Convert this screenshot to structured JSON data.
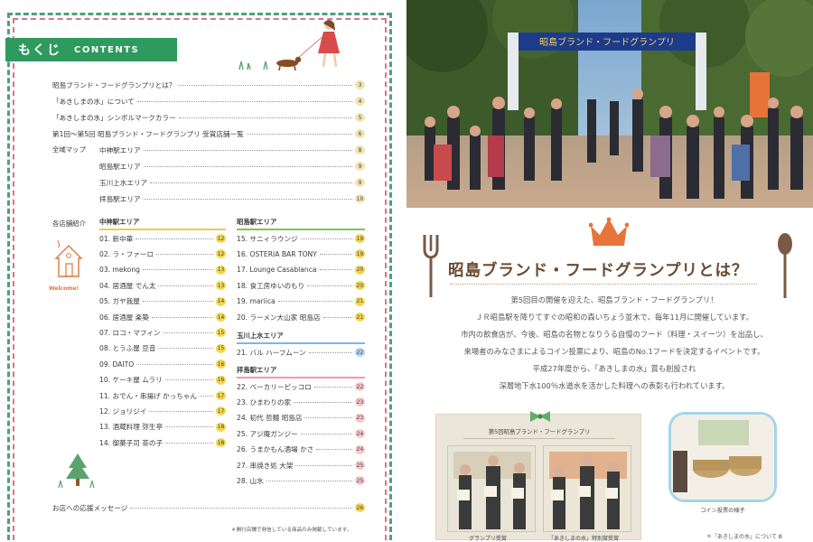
{
  "left": {
    "contents_jp": "もくじ",
    "contents_en": "CONTENTS",
    "toc": [
      {
        "label": "昭島ブランド・フードグランプリとは？",
        "page": "3"
      },
      {
        "label": "「あきしまの水」について",
        "page": "4"
      },
      {
        "label": "「あきしまの水」シンボルマークカラー",
        "page": "5"
      },
      {
        "label": "第1回〜第5回 昭島ブランド・フードグランプリ 受賞店舗一覧",
        "page": "6"
      }
    ],
    "map_label": "全域マップ",
    "map_items": [
      {
        "label": "中神駅エリア",
        "page": "8"
      },
      {
        "label": "昭島駅エリア",
        "page": "9"
      },
      {
        "label": "玉川上水エリア",
        "page": "9"
      },
      {
        "label": "拝島駅エリア",
        "page": "10"
      }
    ],
    "shops_label": "各店舗紹介",
    "welcome": "Welcome!",
    "area_nakagami": "中神駅エリア",
    "shops_nakagami": [
      {
        "label": "01. 新中華",
        "page": "12"
      },
      {
        "label": "02. ラ・ファーロ",
        "page": "12"
      },
      {
        "label": "03. mekong",
        "page": "13"
      },
      {
        "label": "04. 居酒屋 でん太",
        "page": "13"
      },
      {
        "label": "05. ガヤ我屋",
        "page": "14"
      },
      {
        "label": "06. 居酒屋 楽築",
        "page": "14"
      },
      {
        "label": "07. ロコ・マフィン",
        "page": "15"
      },
      {
        "label": "08. とうふ屋 豆音",
        "page": "15"
      },
      {
        "label": "09. DAITO",
        "page": "16"
      },
      {
        "label": "10. ケーキ屋 ムラリ",
        "page": "16"
      },
      {
        "label": "11. おでん・串揚げ かっちゃん",
        "page": "17"
      },
      {
        "label": "12. ジョリジイ",
        "page": "17"
      },
      {
        "label": "13. 酒蔵料理 弥生亭",
        "page": "18"
      },
      {
        "label": "14. 御菓子司 茶の子",
        "page": "18"
      }
    ],
    "area_akishima": "昭島駅エリア",
    "shops_akishima": [
      {
        "label": "15. サニィラウンジ",
        "page": "19"
      },
      {
        "label": "16. OSTERIA BAR TONY",
        "page": "19"
      },
      {
        "label": "17. Lounge Casablanca",
        "page": "20"
      },
      {
        "label": "18. 食工房ゆいのもり",
        "page": "20"
      },
      {
        "label": "19. mariica",
        "page": "21"
      },
      {
        "label": "20. ラーメン大山家 昭島店",
        "page": "21"
      }
    ],
    "area_tamagawa": "玉川上水エリア",
    "shops_tamagawa": [
      {
        "label": "21. バル ハーフムーン",
        "page": "22"
      }
    ],
    "area_haijima": "拝島駅エリア",
    "shops_haijima": [
      {
        "label": "22. ベーカリーピッコロ",
        "page": "22"
      },
      {
        "label": "23. ひまわりの家",
        "page": "23"
      },
      {
        "label": "24. 初代 哲麺 昭島店",
        "page": "23"
      },
      {
        "label": "25. アジ庵ガンジー",
        "page": "24"
      },
      {
        "label": "26. うまかもん酒場 かさ",
        "page": "24"
      },
      {
        "label": "27. 串焼き処 大架",
        "page": "25"
      },
      {
        "label": "28. 山水",
        "page": "25"
      }
    ],
    "support": {
      "label": "お店への応援メッセージ",
      "page": "26"
    },
    "footnote": "＊開行店舗で発信している商品のみ掲載しています。"
  },
  "right": {
    "banner_text": "昭島ブランド・フードグランプリ",
    "title": "昭島ブランド・フードグランプリとは？",
    "body": [
      "第5回目の開催を迎えた、昭島ブランド・フードグランプリ！",
      "ＪＲ昭島駅を降りてすぐの昭和の森いちょう並木で、毎年11月に開催しています。",
      "市内の飲食店が、今後、昭島の名物となりうる自慢のフード（料理・スイーツ）を出品し、",
      "来場者のみなさまによるコイン投票により、昭島のNo.1フードを決定するイベントです。",
      "平成27年度から、「あきしまの水」賞も創設され",
      "深層地下水100％水道水を活かした料理への表彰も行われています。"
    ],
    "box_title": "第5回昭島ブランド・フードグランプリ",
    "caption_left": "グランプリ受賞",
    "caption_right": "「あきしまの水」特別賞受賞",
    "coin_caption": "コイン投票の様子",
    "note": "＊「あきしまの水」について Ⅲ"
  },
  "colors": {
    "green_tab": "#2e9a5d",
    "frame_green": "#4aa37b",
    "frame_pink": "#e0708a",
    "title_brown": "#6b4a2e",
    "crown": "#e8743b"
  }
}
